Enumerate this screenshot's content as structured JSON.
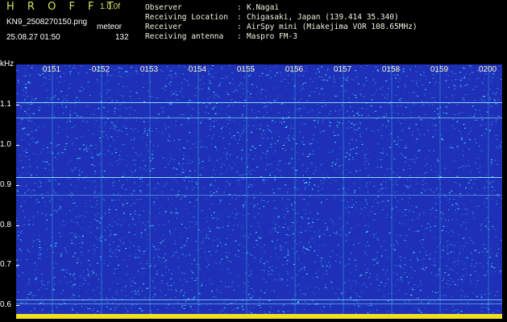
{
  "header": {
    "app_title": "H R O F F T",
    "version": "1.0.0f",
    "filename": "KN9_2508270150.png",
    "meteor_label": "meteor",
    "timestamp": "25.08.27 01:50",
    "meteor_count": "132",
    "fields": [
      {
        "label": "Observer",
        "value": "K.Nagai"
      },
      {
        "label": "Receiving Location",
        "value": "Chigasaki, Japan (139.414 35.340)"
      },
      {
        "label": "Receiver",
        "value": "AirSpy mini (Miakejima VOR 108.65MHz)"
      },
      {
        "label": "Receiving antenna",
        "value": "Maspro FM-3"
      }
    ]
  },
  "plot": {
    "y_unit": "kHz",
    "y_labels": [
      "1.1",
      "1.0",
      "0.9",
      "0.8",
      "0.7",
      "0.6"
    ],
    "time_labels": [
      "0151",
      "0152",
      "0153",
      "0154",
      "0155",
      "0156",
      "0157",
      "0158",
      "0159",
      "0200"
    ],
    "colors": {
      "background": "#1e2fb8",
      "noise_hi": "#44e0ff",
      "noise_mid": "#2c8bd8",
      "line": "#8ff0ff",
      "bottom_band": "#f0e020"
    }
  }
}
